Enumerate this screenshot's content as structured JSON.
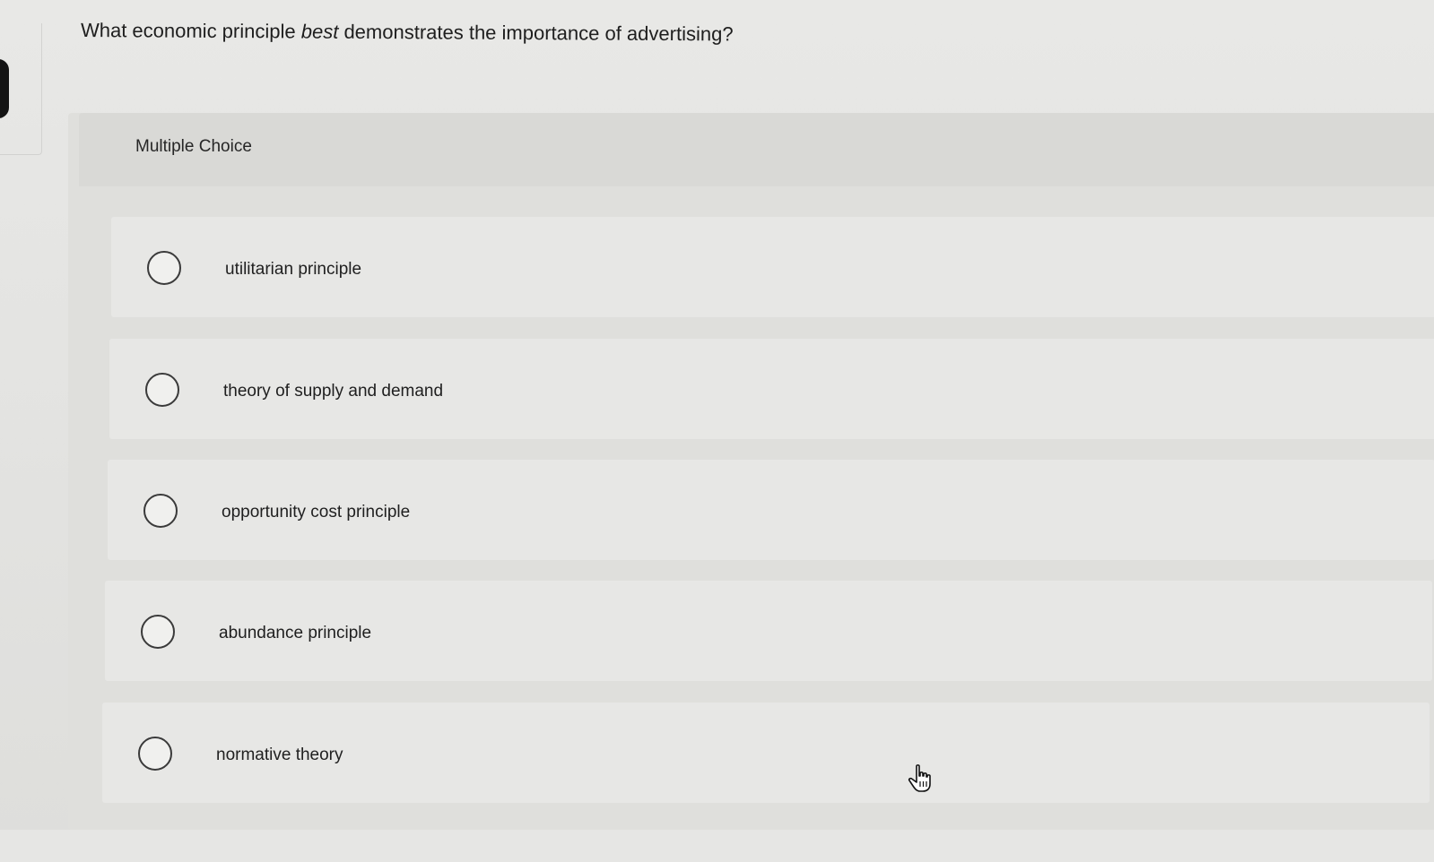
{
  "question": {
    "before_emphasis": "What economic principle ",
    "emphasis": "best",
    "after_emphasis": " demonstrates the importance of advertising?"
  },
  "multiple_choice": {
    "label": "Multiple Choice",
    "options": [
      {
        "label": "utilitarian principle",
        "selected": false
      },
      {
        "label": "theory of supply and demand",
        "selected": false
      },
      {
        "label": "opportunity cost principle",
        "selected": false
      },
      {
        "label": "abundance principle",
        "selected": false
      },
      {
        "label": "normative theory",
        "selected": false
      }
    ]
  },
  "icons": {
    "radio": "radio-unchecked-icon",
    "cursor": "hand-pointer-icon"
  },
  "colors": {
    "page_background": "#e5e5e3",
    "panel_background": "#dfdfdc",
    "option_background": "#e7e7e5",
    "text": "#1e1e1e",
    "radio_border": "#3a3a3a"
  }
}
